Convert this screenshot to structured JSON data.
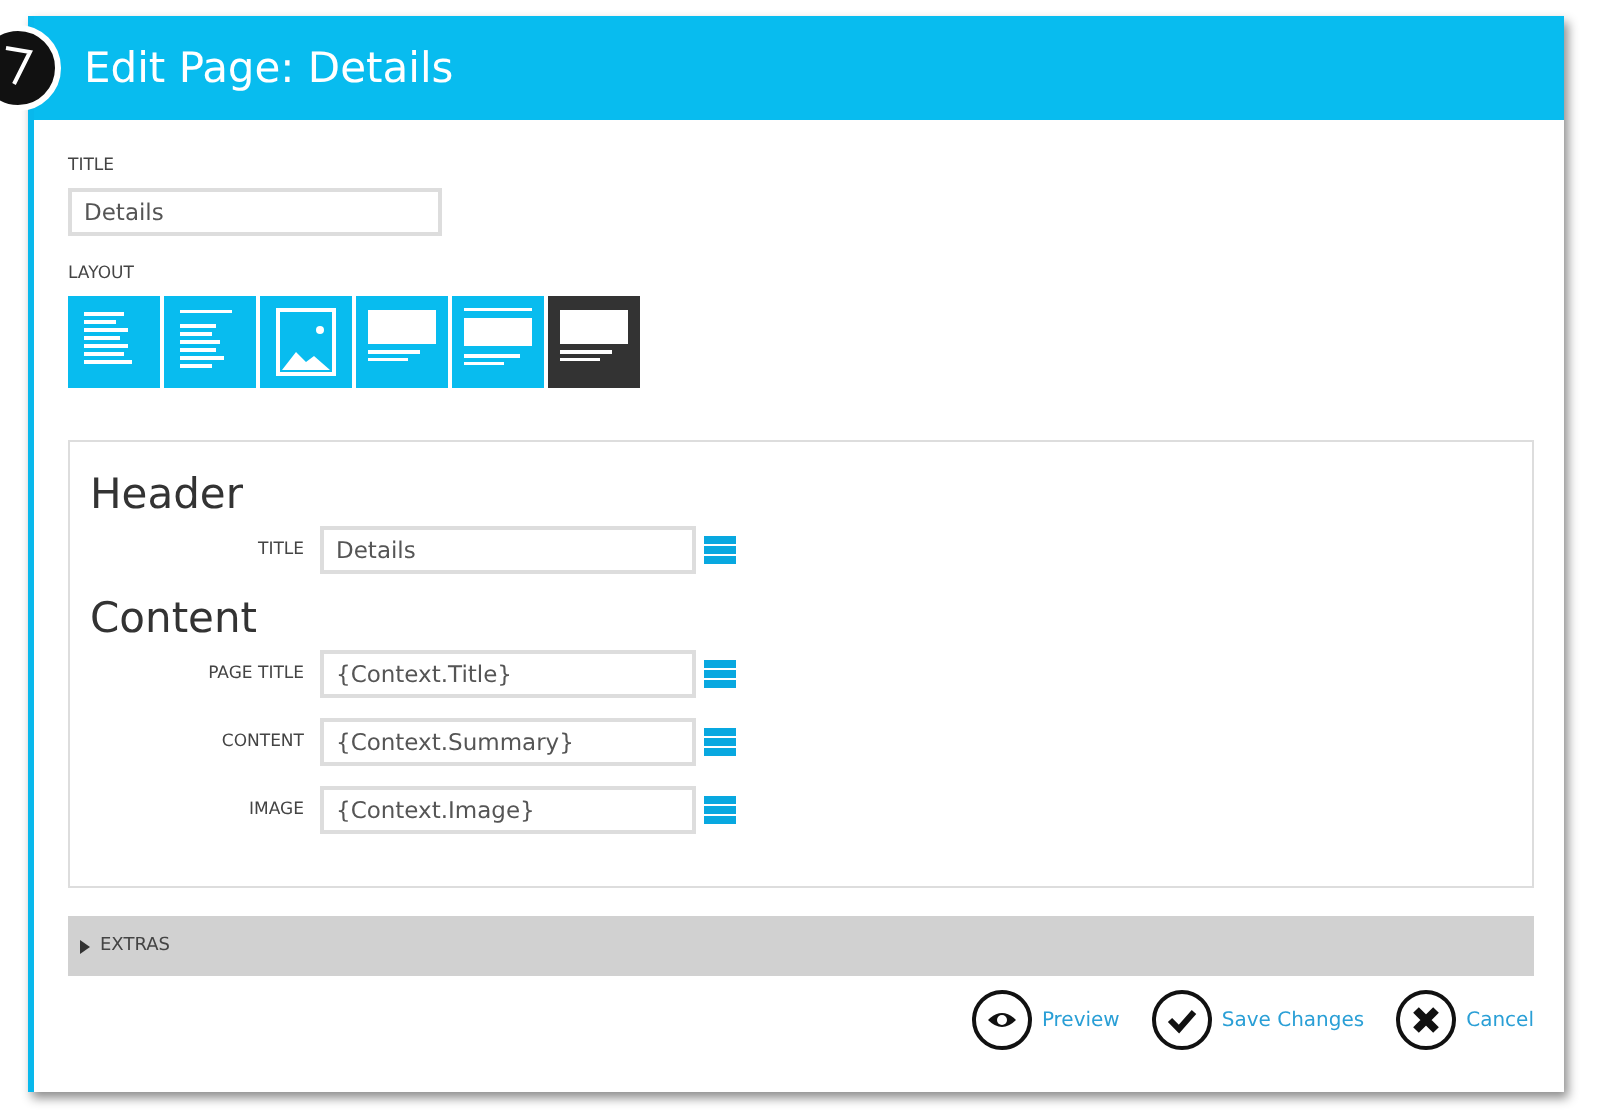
{
  "window": {
    "title": "Edit Page: Details"
  },
  "title_field": {
    "label": "TITLE",
    "value": "Details"
  },
  "layout": {
    "label": "LAYOUT",
    "options": [
      {
        "kind": "text",
        "selected": false
      },
      {
        "kind": "heading-text",
        "selected": false
      },
      {
        "kind": "image",
        "selected": false
      },
      {
        "kind": "banner",
        "selected": false
      },
      {
        "kind": "banner-top",
        "selected": false
      },
      {
        "kind": "banner",
        "selected": true
      }
    ]
  },
  "sections": [
    {
      "heading": "Header",
      "fields": [
        {
          "label": "TITLE",
          "value": "Details"
        }
      ]
    },
    {
      "heading": "Content",
      "fields": [
        {
          "label": "PAGE TITLE",
          "value": "{Context.Title}"
        },
        {
          "label": "CONTENT",
          "value": "{Context.Summary}"
        },
        {
          "label": "IMAGE",
          "value": "{Context.Image}"
        }
      ]
    }
  ],
  "extras": {
    "label": "EXTRAS",
    "expanded": false
  },
  "buttons": [
    {
      "kind": "preview",
      "label": "Preview"
    },
    {
      "kind": "save",
      "label": "Save Changes"
    },
    {
      "kind": "cancel",
      "label": "Cancel"
    }
  ]
}
